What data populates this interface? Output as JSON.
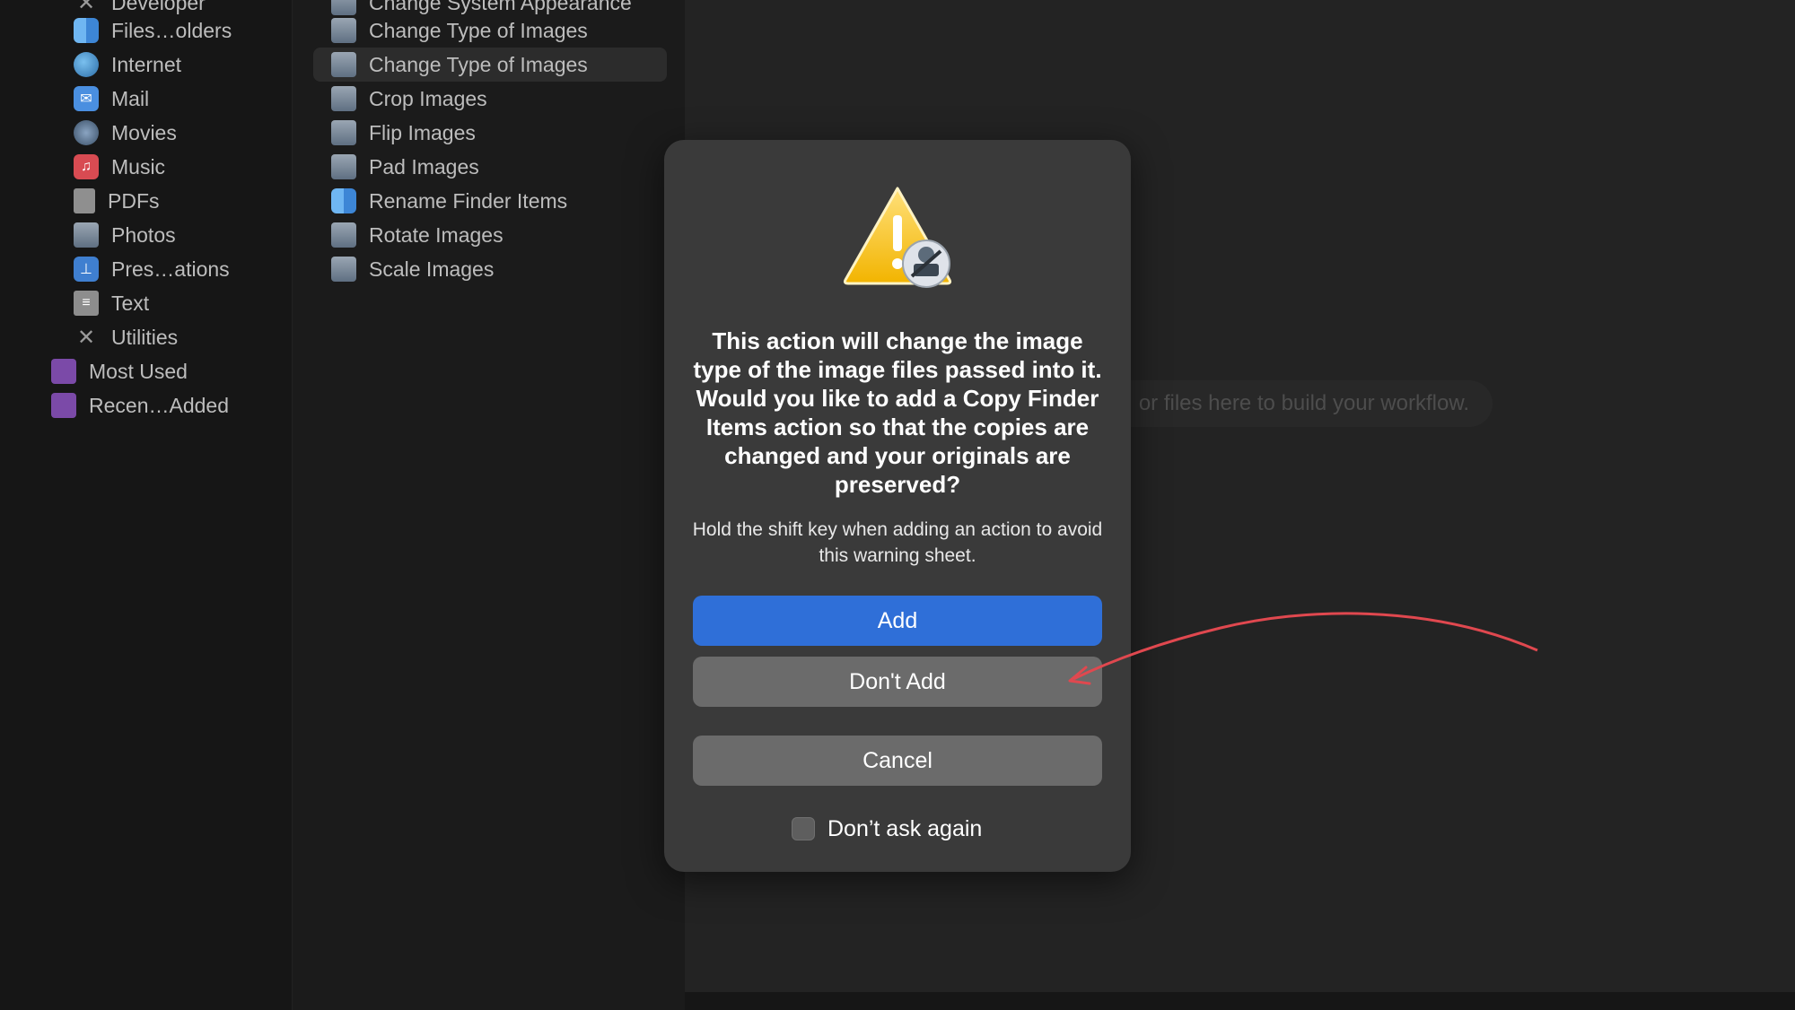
{
  "library": {
    "items": [
      {
        "label": "Developer",
        "icon": "developer-tools-icon"
      },
      {
        "label": "Files…olders",
        "icon": "finder-icon"
      },
      {
        "label": "Internet",
        "icon": "globe-icon"
      },
      {
        "label": "Mail",
        "icon": "mail-icon"
      },
      {
        "label": "Movies",
        "icon": "movies-icon"
      },
      {
        "label": "Music",
        "icon": "music-note-icon"
      },
      {
        "label": "PDFs",
        "icon": "pdf-document-icon"
      },
      {
        "label": "Photos",
        "icon": "photos-icon"
      },
      {
        "label": "Pres…ations",
        "icon": "presentation-icon"
      },
      {
        "label": "Text",
        "icon": "text-document-icon"
      },
      {
        "label": "Utilities",
        "icon": "utilities-tools-icon"
      },
      {
        "label": "Most Used",
        "icon": "smart-folder-icon"
      },
      {
        "label": "Recen…Added",
        "icon": "smart-folder-icon"
      }
    ]
  },
  "actions": {
    "items": [
      {
        "label": "Change System Appearance",
        "icon": "system-appearance-icon"
      },
      {
        "label": "Change Type of Images",
        "icon": "image-type-icon"
      },
      {
        "label": "Change Type of Images",
        "icon": "preview-image-icon",
        "selected": true
      },
      {
        "label": "Crop Images",
        "icon": "preview-image-icon"
      },
      {
        "label": "Flip Images",
        "icon": "preview-image-icon"
      },
      {
        "label": "Pad Images",
        "icon": "preview-image-icon"
      },
      {
        "label": "Rename Finder Items",
        "icon": "finder-icon"
      },
      {
        "label": "Rotate Images",
        "icon": "preview-image-icon"
      },
      {
        "label": "Scale Images",
        "icon": "preview-image-icon"
      }
    ]
  },
  "workflow": {
    "hint": "or files here to build your workflow."
  },
  "dialog": {
    "message": "This action will change the image type of the image files passed into it.  Would you like to add a Copy Finder Items action so that the copies are changed and your originals are preserved?",
    "hint": "Hold the shift key when adding an action to avoid this warning sheet.",
    "add_label": "Add",
    "dont_add_label": "Don't Add",
    "cancel_label": "Cancel",
    "dont_ask_label": "Don’t ask again",
    "dont_ask_checked": false,
    "icon": "warning-triangle-automator-icon"
  },
  "colors": {
    "primary_button": "#2f6fd8",
    "secondary_button": "#6b6b6b",
    "annotation_arrow": "#e0484f"
  }
}
